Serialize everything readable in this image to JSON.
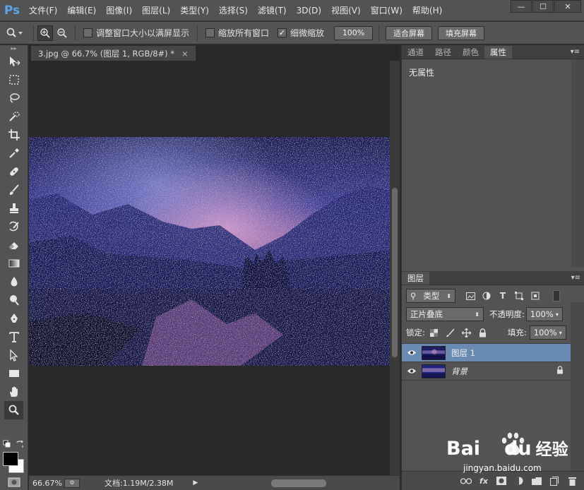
{
  "app": {
    "logo": "Ps"
  },
  "menu": [
    "文件(F)",
    "编辑(E)",
    "图像(I)",
    "图层(L)",
    "类型(Y)",
    "选择(S)",
    "滤镜(T)",
    "3D(D)",
    "视图(V)",
    "窗口(W)",
    "帮助(H)"
  ],
  "window_controls": {
    "minimize": "—",
    "restore": "☐",
    "close": "✕"
  },
  "options": {
    "resize_windows": "调整窗口大小以满屏显示",
    "zoom_all": "缩放所有窗口",
    "scrubby_zoom": "细微缩放",
    "btn_100": "100%",
    "btn_fit": "适合屏幕",
    "btn_fill": "填充屏幕"
  },
  "document": {
    "tab_title": "3.jpg @ 66.7% (图层 1, RGB/8#) *",
    "tab_close": "×"
  },
  "status": {
    "zoom": "66.67%",
    "doc_info": "文档:1.19M/2.38M"
  },
  "right_top": {
    "tabs": [
      "通道",
      "路径",
      "颜色",
      "属性"
    ],
    "active_tab": "属性",
    "properties_text": "无属性"
  },
  "layers": {
    "tab": "图层",
    "filter_type": "类型",
    "blend_mode": "正片叠底",
    "opacity_label": "不透明度:",
    "opacity_value": "100%",
    "lock_label": "锁定:",
    "fill_label": "填充:",
    "fill_value": "100%",
    "items": [
      {
        "name": "图层 1",
        "selected": true
      },
      {
        "name": "背景",
        "selected": false
      }
    ],
    "fx": "fx"
  },
  "watermark": {
    "brand_left": "Bai",
    "brand_mid": "du",
    "brand_right": "经验",
    "url": "jingyan.baidu.com"
  },
  "colors": {
    "menubar": "#535353",
    "canvas": "#282828",
    "selected_layer": "#6a8bb1",
    "ps_blue": "#5aa4e8"
  }
}
